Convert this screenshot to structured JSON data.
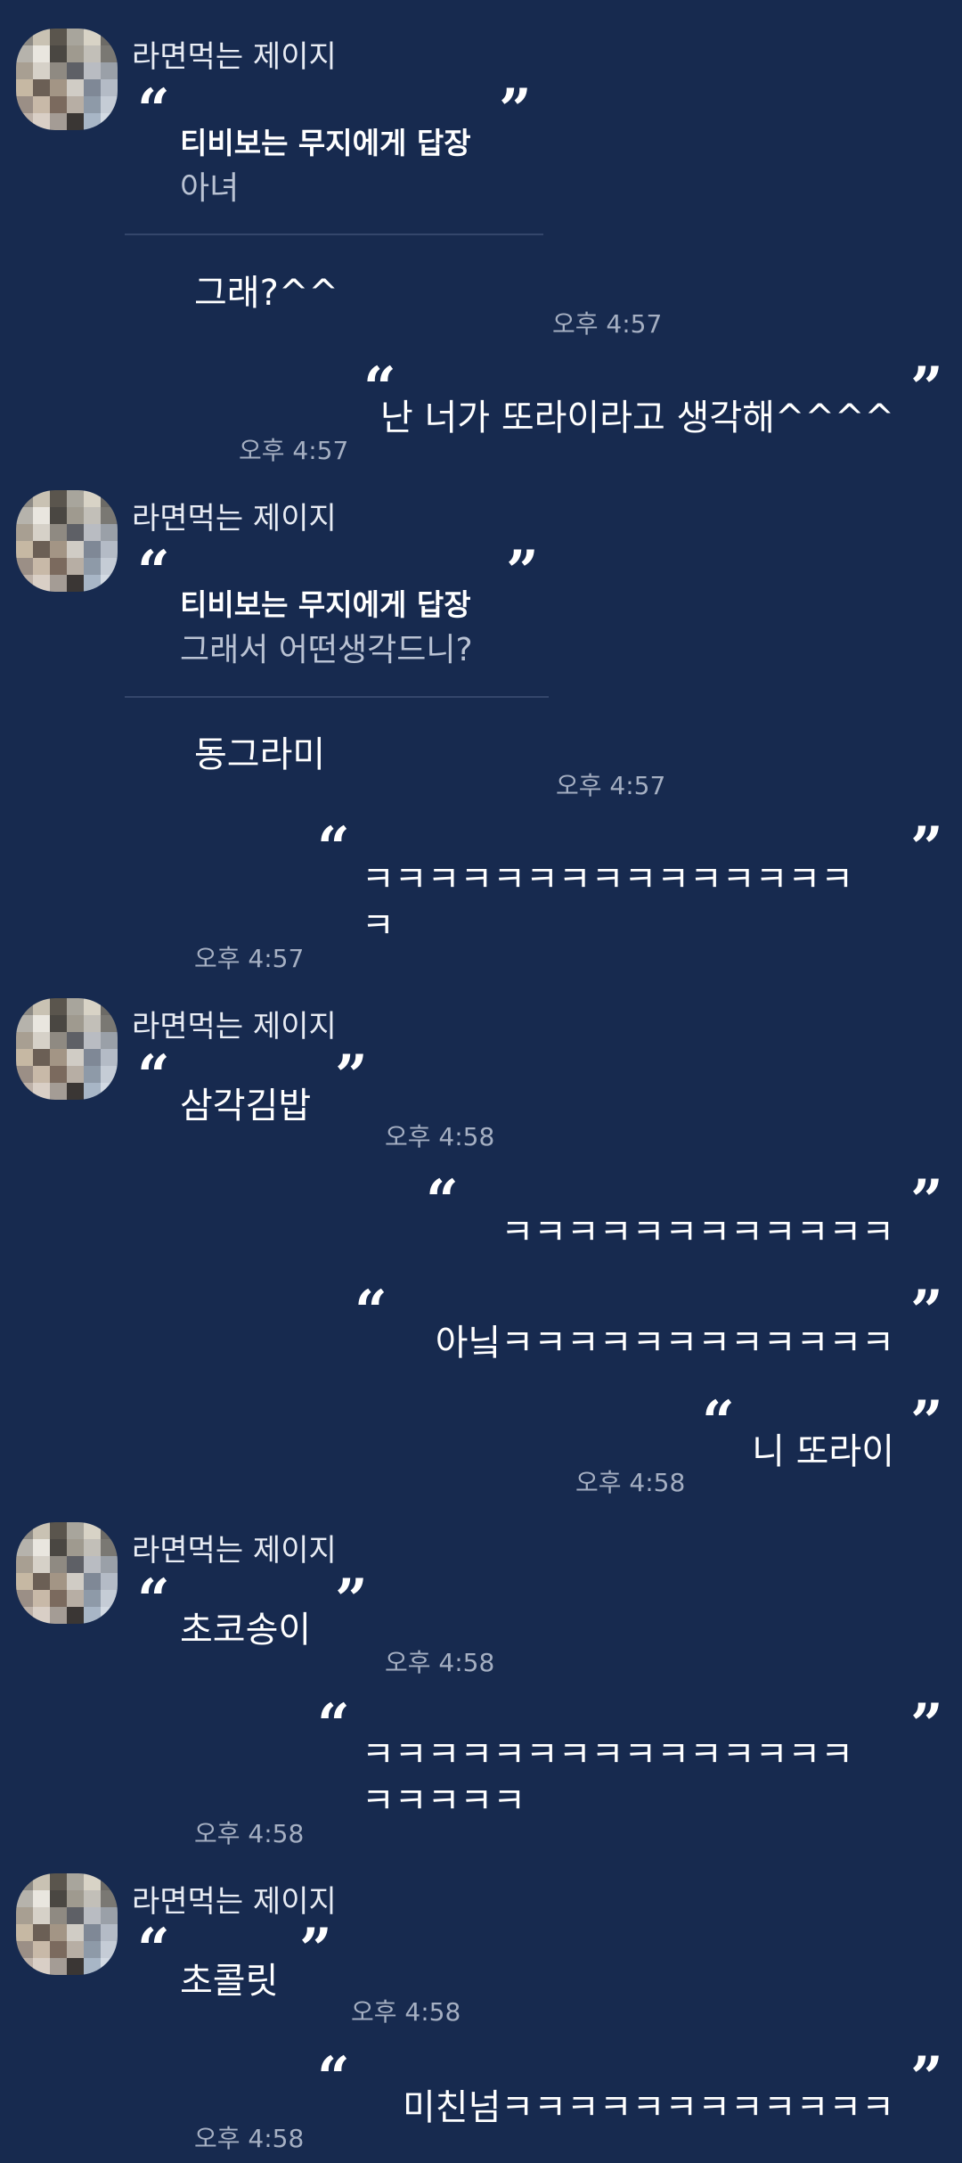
{
  "sender_name": "라면먹는 제이지",
  "avatar_icon": "pixelated-avatar-icon",
  "colors": {
    "background": "#172a4f",
    "text": "#ffffff",
    "muted": "#b9c2d3",
    "time": "#a5afc2",
    "divider": "#34466b"
  },
  "open_quote": "“",
  "close_quote": "”",
  "messages": [
    {
      "reply_to": "티비보는 무지에게 답장",
      "reply_text": "아녀",
      "text": "그래?^^",
      "time": "오후 4:57"
    },
    {
      "text": "난 너가 또라이라고 생각해^^^^",
      "time": "오후 4:57"
    },
    {
      "reply_to": "티비보는 무지에게 답장",
      "reply_text": "그래서 어떤생각드니?",
      "text": "동그라미",
      "time": "오후 4:57"
    },
    {
      "text_line1": "ㅋㅋㅋㅋㅋㅋㅋㅋㅋㅋㅋㅋㅋㅋㅋ",
      "text_line2": "ㅋ",
      "time": "오후 4:57"
    },
    {
      "text": "삼각김밥",
      "time": "오후 4:58"
    },
    {
      "text": "ㅋㅋㅋㅋㅋㅋㅋㅋㅋㅋㅋㅋ"
    },
    {
      "text": "아닠ㅋㅋㅋㅋㅋㅋㅋㅋㅋㅋㅋㅋ"
    },
    {
      "text": "니 또라이",
      "time": "오후 4:58"
    },
    {
      "text": "초코송이",
      "time": "오후 4:58"
    },
    {
      "text_line1": "ㅋㅋㅋㅋㅋㅋㅋㅋㅋㅋㅋㅋㅋㅋㅋ",
      "text_line2": "ㅋㅋㅋㅋㅋ",
      "time": "오후 4:58"
    },
    {
      "text": "초콜릿",
      "time": "오후 4:58"
    },
    {
      "text": "미친넘ㅋㅋㅋㅋㅋㅋㅋㅋㅋㅋㅋㅋ",
      "time": "오후 4:58"
    }
  ]
}
